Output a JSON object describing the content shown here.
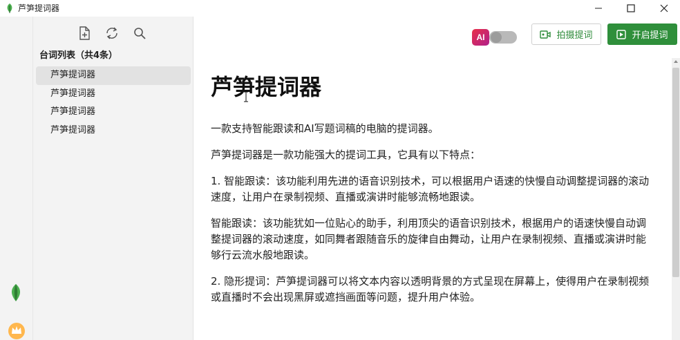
{
  "window": {
    "title": "芦笋提词器",
    "controls": {
      "minimize": "minimize-icon",
      "maximize": "maximize-icon",
      "close": "close-icon"
    }
  },
  "toolbar": {
    "icons": [
      "new-file-icon",
      "refresh-icon",
      "search-icon"
    ]
  },
  "list": {
    "heading": "台词列表（共4条）",
    "items": [
      {
        "label": "芦笋提词器",
        "active": true
      },
      {
        "label": "芦笋提词器",
        "active": false
      },
      {
        "label": "芦笋提词器",
        "active": false
      },
      {
        "label": "芦笋提词器",
        "active": false
      }
    ]
  },
  "header": {
    "ai_badge": "AI",
    "ai_toggle_on": false,
    "shoot_button": "拍摄提词",
    "start_button": "开启提词"
  },
  "document": {
    "title": "芦笋提词器",
    "paragraphs": [
      "一款支持智能跟读和AI写题词稿的电脑的提词器。",
      "芦笋提词器是一款功能强大的提词工具，它具有以下特点：",
      "1. 智能跟读：该功能利用先进的语音识别技术，可以根据用户语速的快慢自动调整提词器的滚动速度，让用户在录制视频、直播或演讲时能够流畅地跟读。",
      "智能跟读：该功能犹如一位贴心的助手，利用顶尖的语音识别技术，根据用户的语速快慢自动调整提词器的滚动速度，如同舞者跟随音乐的旋律自由舞动，让用户在录制视频、直播或演讲时能够行云流水般地跟读。",
      "2. 隐形提词：芦笋提词器可以将文本内容以透明背景的方式呈现在屏幕上，使得用户在录制视频或直播时不会出现黑屏或遮挡画面等问题，提升用户体验。"
    ]
  },
  "colors": {
    "accent_green": "#2f8f3b",
    "sidebar_bg": "#f3f3f3",
    "selected_item_bg": "#e2e2e2"
  }
}
